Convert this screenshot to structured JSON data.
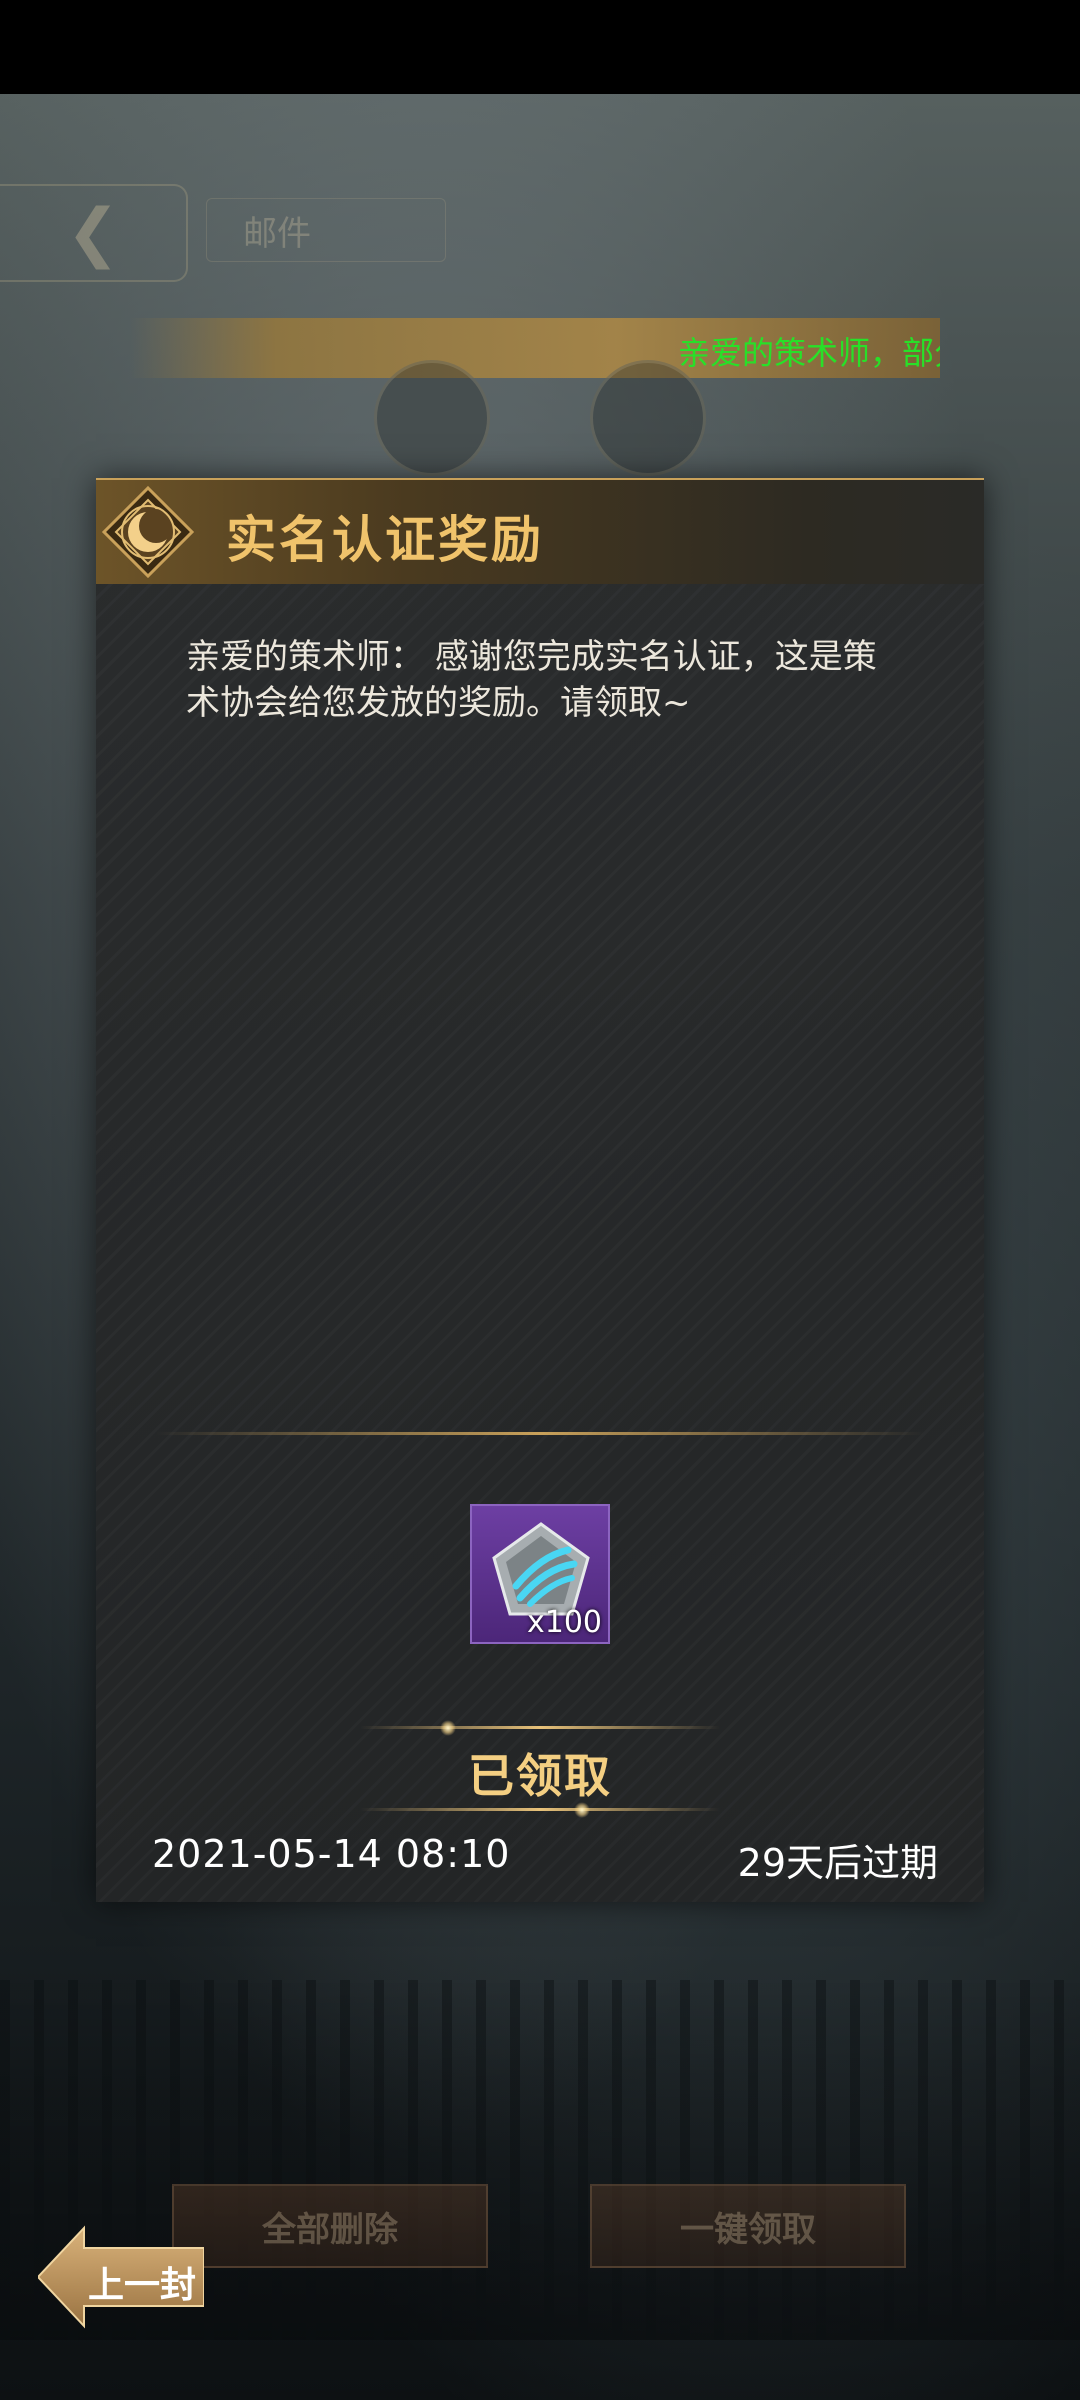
{
  "header": {
    "title": "邮件",
    "back_icon": "back-chevron-icon"
  },
  "marquee": {
    "text": "亲爱的策术师，部分"
  },
  "modal": {
    "title": "实名认证奖励",
    "emblem_icon": "moon-emblem-icon",
    "body": "亲爱的策术师：  感谢您完成实名认证，这是策术协会给您发放的奖励。请领取~",
    "reward": {
      "icon": "claw-rune-icon",
      "quantity": "x100"
    },
    "claim_status": "已领取",
    "date": "2021-05-14  08:10",
    "expire": "29天后过期"
  },
  "bottom": {
    "delete_all": "全部删除",
    "claim_all": "一键领取",
    "prev_mail": "上一封"
  },
  "colors": {
    "title_gold": "#f0c36b",
    "marquee_green": "#28e028",
    "reward_purple": "#6d3fa3"
  }
}
